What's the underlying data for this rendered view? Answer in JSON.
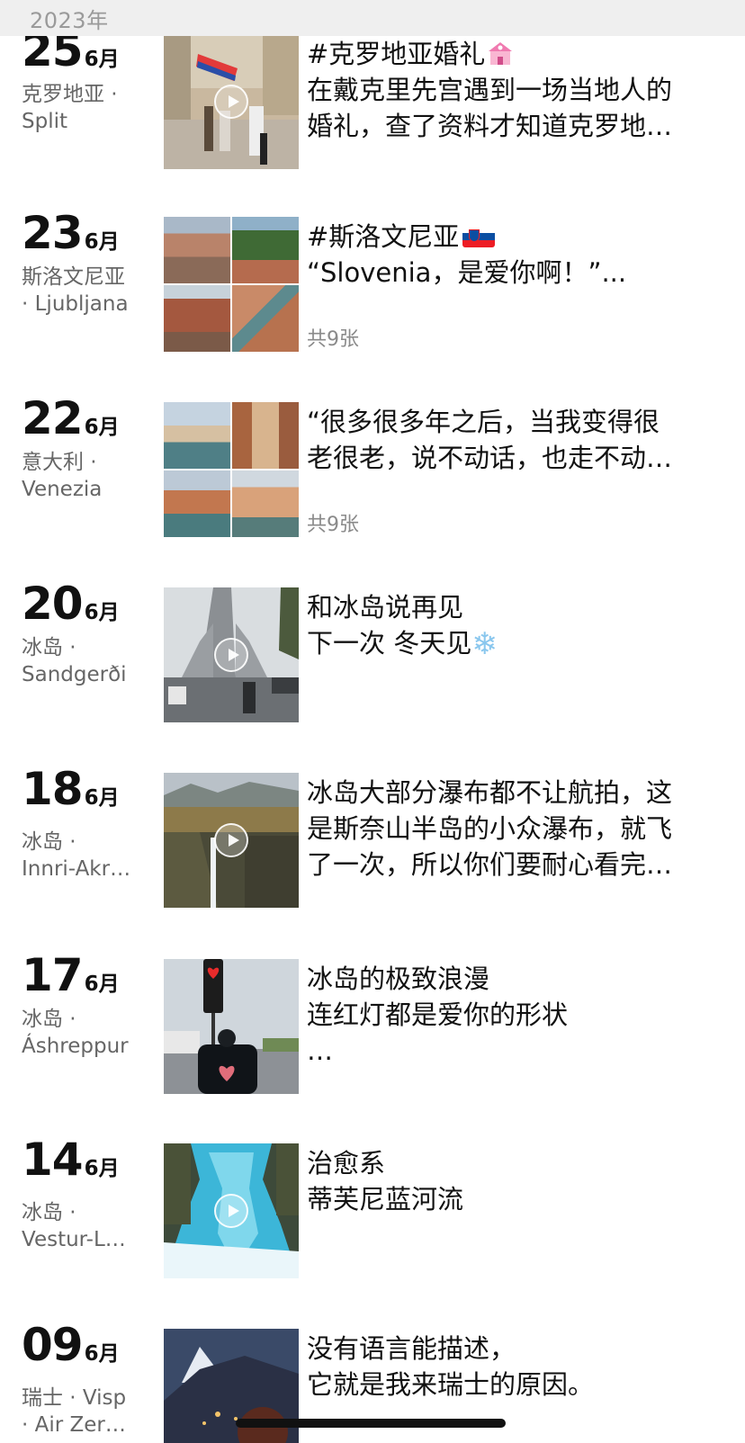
{
  "year_header": "2023年",
  "posts": [
    {
      "day": "25",
      "month": "6月",
      "location_line1": "克罗地亚 ·",
      "location_line2": "Split",
      "lines": [
        "#克罗地亚婚礼",
        "在戴克里先宫遇到一场当地人的",
        "婚礼，查了资料才知道克罗地…"
      ],
      "media": "video",
      "emoji": "house-with-heart-icon"
    },
    {
      "day": "23",
      "month": "6月",
      "location_line1": "斯洛文尼亚",
      "location_line2": "· Ljubljana",
      "lines": [
        "#斯洛文尼亚",
        "“Slovenia，是爱你啊！”..."
      ],
      "media": "grid",
      "count": "共9张",
      "emoji": "slovenia-flag-icon"
    },
    {
      "day": "22",
      "month": "6月",
      "location_line1": "意大利 ·",
      "location_line2": "Venezia",
      "lines": [
        "“很多很多年之后，当我变得很",
        "老很老，说不动话，也走不动…"
      ],
      "media": "grid",
      "count": "共9张"
    },
    {
      "day": "20",
      "month": "6月",
      "location_line1": "冰岛 ·",
      "location_line2": "Sandgerði",
      "lines": [
        "和冰岛说再见",
        "下一次 冬天见"
      ],
      "media": "video",
      "emoji": "snowflake-icon"
    },
    {
      "day": "18",
      "month": "6月",
      "location_line1": "冰岛 ·",
      "location_line2": "Innri-Akr…",
      "lines": [
        "冰岛大部分瀑布都不让航拍，这",
        "是斯奈山半岛的小众瀑布，就飞",
        "了一次，所以你们要耐心看完…"
      ],
      "media": "video"
    },
    {
      "day": "17",
      "month": "6月",
      "location_line1": "冰岛 ·",
      "location_line2": "Áshreppur",
      "lines": [
        "冰岛的极致浪漫",
        "连红灯都是爱你的形状",
        "…"
      ],
      "media": "photo"
    },
    {
      "day": "14",
      "month": "6月",
      "location_line1": "冰岛 ·",
      "location_line2": "Vestur-L…",
      "lines": [
        "治愈系",
        "蒂芙尼蓝河流"
      ],
      "media": "video"
    },
    {
      "day": "09",
      "month": "6月",
      "location_line1": "瑞士 · Visp",
      "location_line2": "· Air Zer…",
      "lines": [
        "没有语言能描述，",
        "它就是我来瑞士的原因。"
      ],
      "media": "photo"
    }
  ],
  "colors": {
    "header_bg": "#efefef",
    "secondary_text": "#666666",
    "count_text": "#8a8a8a"
  }
}
